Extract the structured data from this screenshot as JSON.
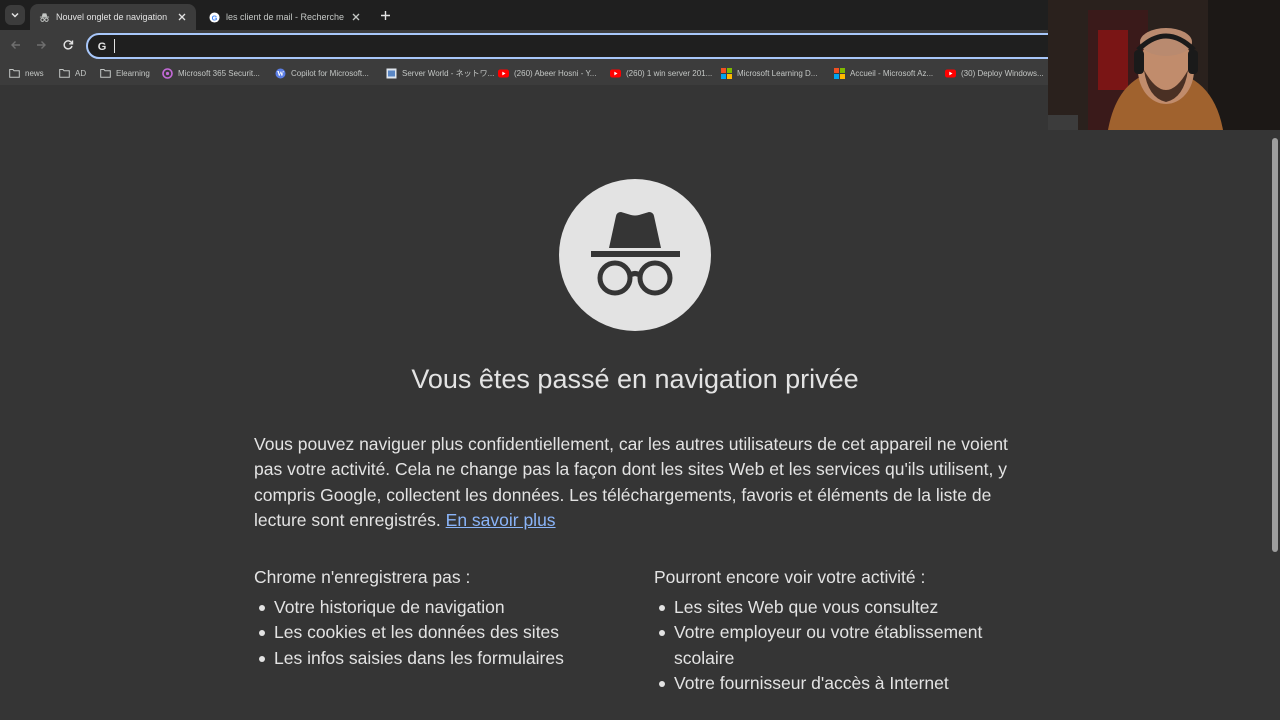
{
  "tabs": [
    {
      "title": "Nouvel onglet de navigation privée",
      "active": true,
      "icon": "incognito-icon"
    },
    {
      "title": "les client de mail - Recherche Google",
      "active": false,
      "icon": "google-icon"
    }
  ],
  "toolbar": {
    "address_value": ""
  },
  "bookmarks": [
    {
      "label": "news",
      "icon": "folder-icon"
    },
    {
      "label": "AD",
      "icon": "folder-icon"
    },
    {
      "label": "Elearning",
      "icon": "folder-icon"
    },
    {
      "label": "Microsoft 365 Securit...",
      "icon": "m365-icon"
    },
    {
      "label": "Copilot for Microsoft...",
      "icon": "wordpress-icon"
    },
    {
      "label": "Server World - ネットワ...",
      "icon": "serverworld-icon"
    },
    {
      "label": "(260) Abeer Hosni - Y...",
      "icon": "youtube-icon"
    },
    {
      "label": "(260) 1 win server 201...",
      "icon": "youtube-icon"
    },
    {
      "label": "Microsoft Learning D...",
      "icon": "microsoft-icon"
    },
    {
      "label": "Accueil - Microsoft Az...",
      "icon": "microsoft-icon"
    },
    {
      "label": "(30) Deploy Windows...",
      "icon": "youtube-icon"
    }
  ],
  "page": {
    "headline": "Vous êtes passé en navigation privée",
    "intro": "Vous pouvez naviguer plus confidentiellement, car les autres utilisateurs de cet appareil ne voient pas votre activité. Cela ne change pas la façon dont les sites Web et les services qu'ils utilisent, y compris Google, collectent les données. Les téléchargements, favoris et éléments de la liste de lecture sont enregistrés.",
    "learn_more": "En savoir plus",
    "left_heading": "Chrome n'enregistrera pas :",
    "left_items": [
      "Votre historique de navigation",
      "Les cookies et les données des sites",
      "Les infos saisies dans les formulaires"
    ],
    "right_heading": "Pourront encore voir votre activité :",
    "right_items": [
      "Les sites Web que vous consultez",
      "Votre employeur ou votre établissement scolaire",
      "Votre fournisseur d'accès à Internet"
    ]
  },
  "colors": {
    "page_bg": "#353535",
    "toolbar_bg": "#3c3c3c",
    "tabstrip_bg": "#1f1f1f",
    "link": "#8ab4f8",
    "omnibox_focus": "#a8c7fa"
  }
}
